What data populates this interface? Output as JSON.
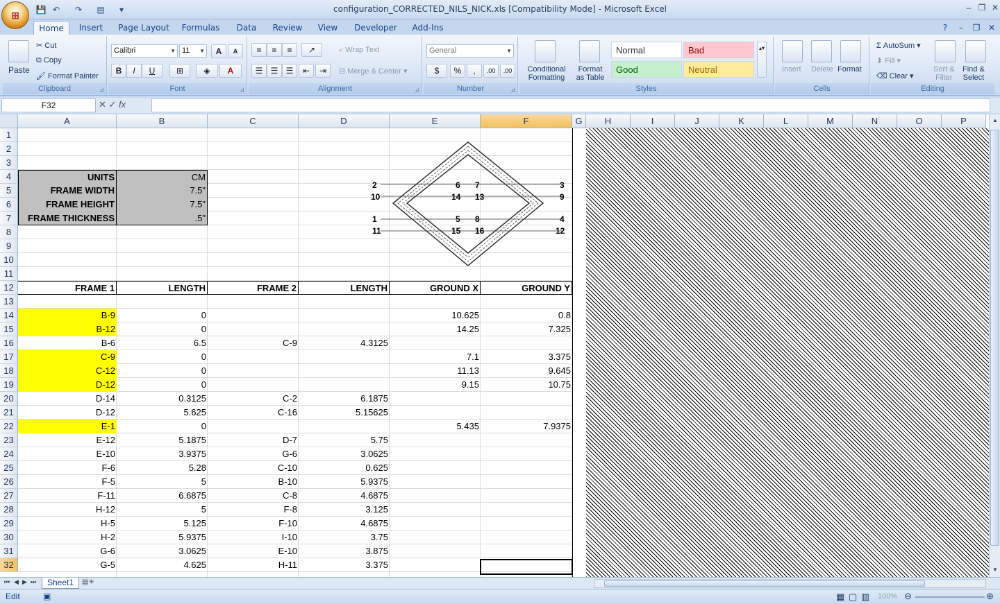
{
  "window": {
    "title": "configuration_CORRECTED_NILS_NICK.xls  [Compatibility Mode] - Microsoft Excel",
    "minimize": "–",
    "maximize": "❐",
    "close": "✕"
  },
  "ribbon": {
    "tabs": [
      "Home",
      "Insert",
      "Page Layout",
      "Formulas",
      "Data",
      "Review",
      "View",
      "Developer",
      "Add-Ins"
    ],
    "clipboard": {
      "label": "Clipboard",
      "paste": "Paste",
      "cut": "Cut",
      "copy": "Copy",
      "format_painter": "Format Painter"
    },
    "font": {
      "label": "Font",
      "name": "Calibri",
      "size": "11",
      "bold": "B",
      "italic": "I",
      "underline": "U",
      "grow": "A",
      "shrink": "A",
      "font_color": "A"
    },
    "alignment": {
      "label": "Alignment",
      "wrap_text": "Wrap Text",
      "merge_center": "Merge & Center"
    },
    "number": {
      "label": "Number",
      "format": "General",
      "currency": "$",
      "percent": "%",
      "comma": ",",
      "inc_decimal": ".00",
      "dec_decimal": ".00"
    },
    "styles": {
      "label": "Styles",
      "conditional": "Conditional",
      "formatting": "Formatting",
      "format": "Format",
      "as_table": "as Table",
      "normal": "Normal",
      "bad": "Bad",
      "good": "Good",
      "neutral": "Neutral"
    },
    "cells": {
      "label": "Cells",
      "insert": "Insert",
      "delete": "Delete",
      "format": "Format"
    },
    "editing": {
      "label": "Editing",
      "autosum": "AutoSum",
      "fill": "Fill",
      "clear": "Clear",
      "sort": "Sort &",
      "filter": "Filter",
      "find": "Find &",
      "select": "Select"
    }
  },
  "formula_bar": {
    "name_box": "F32",
    "fx": "fx",
    "value": ""
  },
  "columns": [
    "A",
    "B",
    "C",
    "D",
    "E",
    "F",
    "G",
    "H",
    "I",
    "J",
    "K",
    "L",
    "M",
    "N",
    "O",
    "P"
  ],
  "selected_cell": "F32",
  "sheet": {
    "units": {
      "label": "UNITS",
      "value": "CM"
    },
    "frame_width": {
      "label": "FRAME WIDTH",
      "value": "7.5\""
    },
    "frame_height": {
      "label": "FRAME HEIGHT",
      "value": "7.5\""
    },
    "frame_thickness": {
      "label": "FRAME THICKNESS",
      "value": ".5\""
    },
    "headers": [
      "FRAME 1",
      "LENGTH",
      "FRAME 2",
      "LENGTH",
      "GROUND X",
      "GROUND Y"
    ],
    "rows": [
      {
        "row": 14,
        "a": "B-9",
        "b": "0",
        "c": "",
        "d": "",
        "e": "10.625",
        "f": "0.8",
        "hl": true
      },
      {
        "row": 15,
        "a": "B-12",
        "b": "0",
        "c": "",
        "d": "",
        "e": "14.25",
        "f": "7.325",
        "hl": true
      },
      {
        "row": 16,
        "a": "B-6",
        "b": "6.5",
        "c": "C-9",
        "d": "4.3125",
        "e": "",
        "f": "",
        "hl": false
      },
      {
        "row": 17,
        "a": "C-9",
        "b": "0",
        "c": "",
        "d": "",
        "e": "7.1",
        "f": "3.375",
        "hl": true
      },
      {
        "row": 18,
        "a": "C-12",
        "b": "0",
        "c": "",
        "d": "",
        "e": "11.13",
        "f": "9.645",
        "hl": true
      },
      {
        "row": 19,
        "a": "D-12",
        "b": "0",
        "c": "",
        "d": "",
        "e": "9.15",
        "f": "10.75",
        "hl": true
      },
      {
        "row": 20,
        "a": "D-14",
        "b": "0.3125",
        "c": "C-2",
        "d": "6.1875",
        "e": "",
        "f": "",
        "hl": false
      },
      {
        "row": 21,
        "a": "D-12",
        "b": "5.625",
        "c": "C-16",
        "d": "5.15625",
        "e": "",
        "f": "",
        "hl": false
      },
      {
        "row": 22,
        "a": "E-1",
        "b": "0",
        "c": "",
        "d": "",
        "e": "5.435",
        "f": "7.9375",
        "hl": true
      },
      {
        "row": 23,
        "a": "E-12",
        "b": "5.1875",
        "c": "D-7",
        "d": "5.75",
        "e": "",
        "f": "",
        "hl": false
      },
      {
        "row": 24,
        "a": "E-10",
        "b": "3.9375",
        "c": "G-6",
        "d": "3.0625",
        "e": "",
        "f": "",
        "hl": false
      },
      {
        "row": 25,
        "a": "F-6",
        "b": "5.28",
        "c": "C-10",
        "d": "0.625",
        "e": "",
        "f": "",
        "hl": false
      },
      {
        "row": 26,
        "a": "F-5",
        "b": "5",
        "c": "B-10",
        "d": "5.9375",
        "e": "",
        "f": "",
        "hl": false
      },
      {
        "row": 27,
        "a": "F-11",
        "b": "6.6875",
        "c": "C-8",
        "d": "4.6875",
        "e": "",
        "f": "",
        "hl": false
      },
      {
        "row": 28,
        "a": "H-12",
        "b": "5",
        "c": "F-8",
        "d": "3.125",
        "e": "",
        "f": "",
        "hl": false
      },
      {
        "row": 29,
        "a": "H-5",
        "b": "5.125",
        "c": "F-10",
        "d": "4.6875",
        "e": "",
        "f": "",
        "hl": false
      },
      {
        "row": 30,
        "a": "H-2",
        "b": "5.9375",
        "c": "I-10",
        "d": "3.75",
        "e": "",
        "f": "",
        "hl": false
      },
      {
        "row": 31,
        "a": "G-6",
        "b": "3.0625",
        "c": "E-10",
        "d": "3.875",
        "e": "",
        "f": "",
        "hl": false
      },
      {
        "row": 32,
        "a": "G-5",
        "b": "4.625",
        "c": "H-11",
        "d": "3.375",
        "e": "",
        "f": "",
        "hl": false
      }
    ]
  },
  "diagram_labels": {
    "n1": "1",
    "n2": "2",
    "n3": "3",
    "n4": "4",
    "n5": "5",
    "n6": "6",
    "n7": "7",
    "n8": "8",
    "n9": "9",
    "n10": "10",
    "n11": "11",
    "n12": "12",
    "n13": "13",
    "n14": "14",
    "n15": "15",
    "n16": "16"
  },
  "sheet_tabs": [
    "Sheet1"
  ],
  "status": {
    "mode": "Edit",
    "zoom": "100%"
  }
}
